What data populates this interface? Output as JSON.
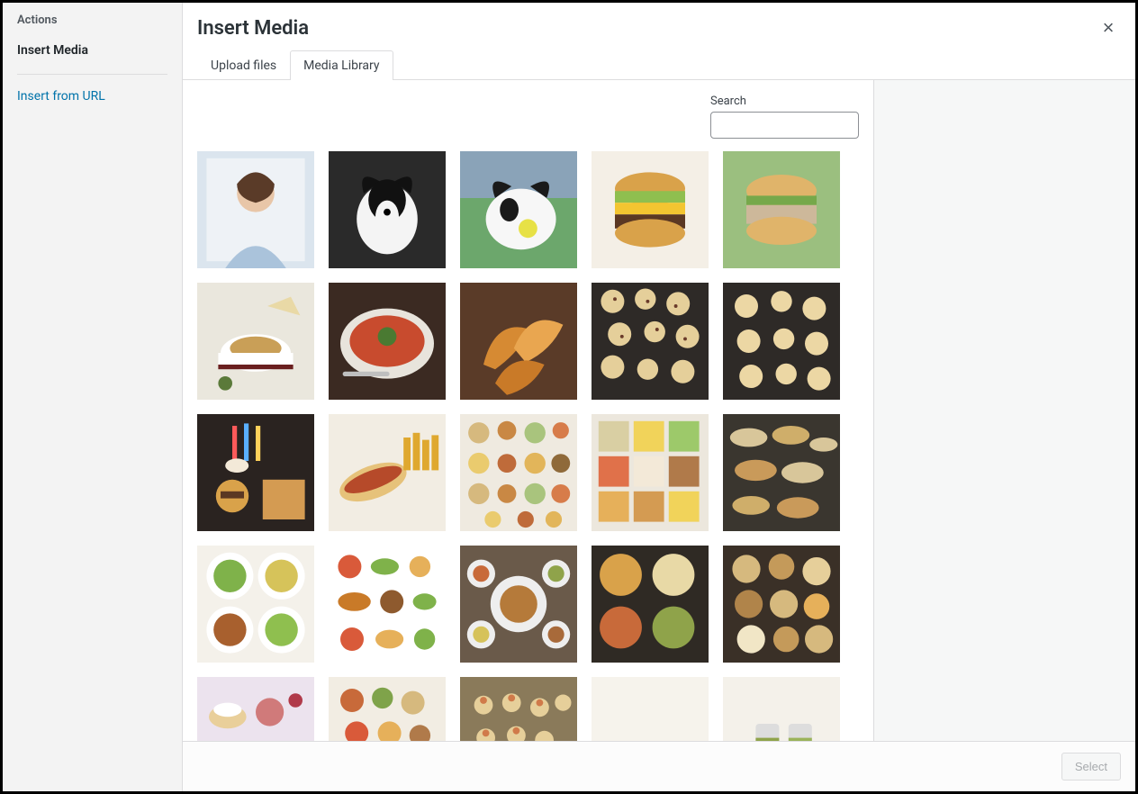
{
  "sidebar": {
    "heading": "Actions",
    "menu": {
      "insert_media": "Insert Media"
    },
    "link": {
      "insert_from_url": "Insert from URL"
    }
  },
  "header": {
    "title": "Insert Media",
    "close_icon": "×"
  },
  "tabs": {
    "upload": "Upload files",
    "library": "Media Library"
  },
  "search": {
    "label": "Search",
    "value": ""
  },
  "footer": {
    "select_label": "Select"
  },
  "media": [
    {
      "name": "woman-portrait"
    },
    {
      "name": "dog-bw-portrait"
    },
    {
      "name": "dog-with-ball"
    },
    {
      "name": "cheeseburger"
    },
    {
      "name": "tuna-sandwich"
    },
    {
      "name": "french-onion-soup"
    },
    {
      "name": "tomato-soup"
    },
    {
      "name": "croissants"
    },
    {
      "name": "scones-tray-1"
    },
    {
      "name": "scones-tray-2"
    },
    {
      "name": "diner-food-spread"
    },
    {
      "name": "hotdog-fries"
    },
    {
      "name": "assorted-dishes-flatlay"
    },
    {
      "name": "ingredients-prep"
    },
    {
      "name": "platters-buffet"
    },
    {
      "name": "salads-collage"
    },
    {
      "name": "food-illustrations"
    },
    {
      "name": "feast-table"
    },
    {
      "name": "soups-variety"
    },
    {
      "name": "grains-nuts-bowls"
    },
    {
      "name": "desserts-pastries"
    },
    {
      "name": "charcuterie-bites"
    },
    {
      "name": "canapes"
    },
    {
      "name": "folded-linen"
    },
    {
      "name": "green-smoothie-jars"
    }
  ]
}
